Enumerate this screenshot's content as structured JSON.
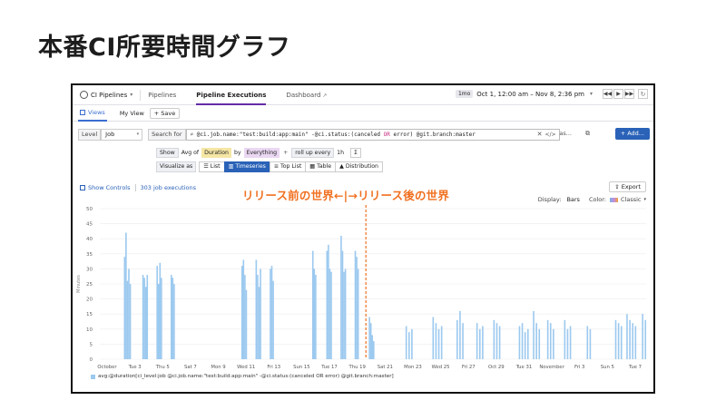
{
  "slide": {
    "title": "本番CI所要時間グラフ"
  },
  "topbar": {
    "app_name": "CI Pipelines",
    "tabs": [
      {
        "label": "Pipelines",
        "active": false
      },
      {
        "label": "Pipeline Executions",
        "active": true
      },
      {
        "label": "Dashboard",
        "active": false
      }
    ],
    "time_badge": "1mo",
    "time_range": "Oct 1, 12:00 am – Nov 8, 2:36 pm"
  },
  "viewbar": {
    "views_label": "Views",
    "my_view_label": "My View",
    "save_label": "Save"
  },
  "search": {
    "level_label": "Level",
    "level_value": "Job",
    "search_for_label": "Search for",
    "query_part1": "@ci.job.name:\"test:build:app:main\"  -@ci.status:(canceled ",
    "query_or": "OR",
    "query_part2": " error)  @git.branch:master",
    "as_label": "as...",
    "add_label": "Add..."
  },
  "show_row": {
    "show_label": "Show",
    "avg_of": "Avg of",
    "measure": "Duration",
    "by_label": "by",
    "group": "Everything",
    "rollup_label": "roll up every",
    "rollup_value": "1h",
    "sigma": "Σ"
  },
  "visualize_row": {
    "label": "Visualize as",
    "options": [
      {
        "label": "List",
        "icon": "list-icon",
        "active": false
      },
      {
        "label": "Timeseries",
        "icon": "timeseries-icon",
        "active": true
      },
      {
        "label": "Top List",
        "icon": "toplist-icon",
        "active": false
      },
      {
        "label": "Table",
        "icon": "table-icon",
        "active": false
      },
      {
        "label": "Distribution",
        "icon": "distribution-icon",
        "active": false
      }
    ]
  },
  "controls": {
    "show_controls": "Show Controls",
    "executions": "303 job executions",
    "export_label": "Export",
    "display_label": "Display:",
    "display_value": "Bars",
    "color_label": "Color:",
    "color_value": "Classic"
  },
  "annotation": {
    "text": "リリース前の世界←|→リリース後の世界",
    "color": "#f07020"
  },
  "colors": {
    "bar": "#9cc9ef",
    "accent": "#2a62b8",
    "annotation": "#f07020"
  },
  "chart_data": {
    "type": "bar",
    "ylabel": "Minutes",
    "ylim": [
      0,
      50
    ],
    "yticks": [
      0,
      5,
      10,
      15,
      20,
      25,
      30,
      35,
      40,
      45,
      50
    ],
    "xlim_days": [
      0,
      38.6
    ],
    "x_tick_labels": [
      "October",
      "Tue 3",
      "Thu 5",
      "Sat 7",
      "Mon 9",
      "Wed 11",
      "Fri 13",
      "Sun 15",
      "Tue 17",
      "Thu 19",
      "Sat 21",
      "Mon 23",
      "Wed 25",
      "Fri 27",
      "Oct 29",
      "Tue 31",
      "November",
      "Fri 3",
      "Sun 5",
      "Tue 7"
    ],
    "marker_day": 18.8,
    "series": [
      {
        "name": "avg:@duration[ci_level:job @ci.job.name:\"test:build:app:main\" -@ci.status:(canceled OR error) @git.branch:master]",
        "points": [
          [
            1.7,
            34
          ],
          [
            1.8,
            42
          ],
          [
            1.9,
            26
          ],
          [
            2.0,
            30
          ],
          [
            2.1,
            25
          ],
          [
            3.0,
            28
          ],
          [
            3.1,
            27
          ],
          [
            3.2,
            24
          ],
          [
            3.3,
            28
          ],
          [
            4.0,
            31
          ],
          [
            4.1,
            25
          ],
          [
            4.2,
            32
          ],
          [
            4.3,
            27
          ],
          [
            5.0,
            28
          ],
          [
            5.1,
            27
          ],
          [
            5.2,
            25
          ],
          [
            10.0,
            31
          ],
          [
            10.1,
            33
          ],
          [
            10.2,
            28
          ],
          [
            10.3,
            23
          ],
          [
            11.0,
            33
          ],
          [
            11.1,
            28
          ],
          [
            11.2,
            24
          ],
          [
            11.3,
            30
          ],
          [
            12.0,
            30
          ],
          [
            12.1,
            31
          ],
          [
            12.2,
            26
          ],
          [
            15.0,
            36
          ],
          [
            15.1,
            30
          ],
          [
            15.2,
            28
          ],
          [
            16.0,
            36
          ],
          [
            16.1,
            38
          ],
          [
            16.2,
            30
          ],
          [
            16.3,
            29
          ],
          [
            17.0,
            41
          ],
          [
            17.1,
            36
          ],
          [
            17.2,
            29
          ],
          [
            17.3,
            30
          ],
          [
            18.0,
            36
          ],
          [
            18.1,
            34
          ],
          [
            18.2,
            30
          ],
          [
            19.0,
            14
          ],
          [
            19.1,
            12
          ],
          [
            19.2,
            8
          ],
          [
            19.3,
            6
          ],
          [
            21.6,
            11
          ],
          [
            21.8,
            9
          ],
          [
            22.0,
            10
          ],
          [
            23.5,
            14
          ],
          [
            23.7,
            12
          ],
          [
            23.9,
            10
          ],
          [
            24.1,
            11
          ],
          [
            25.2,
            13
          ],
          [
            25.4,
            16
          ],
          [
            25.6,
            12
          ],
          [
            26.6,
            12
          ],
          [
            26.8,
            10
          ],
          [
            27.0,
            11
          ],
          [
            27.8,
            13
          ],
          [
            28.0,
            12
          ],
          [
            28.2,
            11
          ],
          [
            29.6,
            11
          ],
          [
            29.8,
            12
          ],
          [
            30.0,
            9
          ],
          [
            30.2,
            10
          ],
          [
            30.6,
            16
          ],
          [
            30.8,
            12
          ],
          [
            31.0,
            10
          ],
          [
            31.6,
            13
          ],
          [
            31.8,
            12
          ],
          [
            32.0,
            10
          ],
          [
            32.8,
            13
          ],
          [
            33.0,
            10
          ],
          [
            33.2,
            11
          ],
          [
            34.4,
            11
          ],
          [
            34.6,
            10
          ],
          [
            36.4,
            13
          ],
          [
            36.6,
            12
          ],
          [
            36.8,
            11
          ],
          [
            37.2,
            15
          ],
          [
            37.4,
            13
          ],
          [
            37.6,
            12
          ],
          [
            37.8,
            11
          ],
          [
            38.3,
            15
          ],
          [
            38.5,
            13
          ]
        ]
      }
    ]
  }
}
